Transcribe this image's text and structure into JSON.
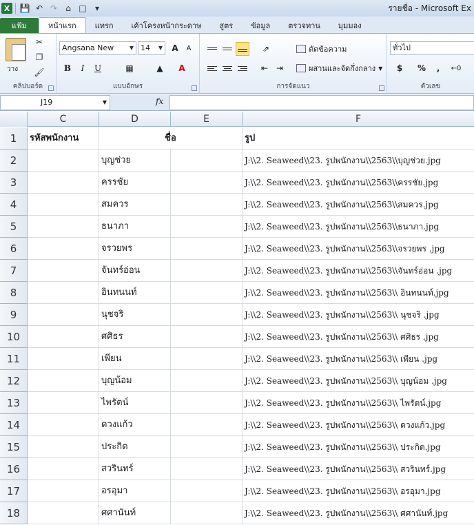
{
  "window": {
    "title": "รายชื่อ - Microsoft Ex"
  },
  "ribbon": {
    "file_tab": "แฟ้ม",
    "tabs": [
      "หน้าแรก",
      "แทรก",
      "เค้าโครงหน้ากระดาษ",
      "สูตร",
      "ข้อมูล",
      "ตรวจทาน",
      "มุมมอง"
    ],
    "clipboard": {
      "paste_label": "วาง",
      "group_label": "คลิปบอร์ด"
    },
    "font": {
      "name": "Angsana New",
      "size": "14",
      "group_label": "แบบอักษร",
      "bold": "B",
      "italic": "I",
      "underline": "U",
      "grow": "A",
      "shrink": "A",
      "color": "A"
    },
    "alignment": {
      "wrap_text": "ตัดข้อความ",
      "merge_center": "ผสานและจัดกึ่งกลาง",
      "group_label": "การจัดแนว"
    },
    "number": {
      "format": "ทั่วไป",
      "currency": "$",
      "percent": "%",
      "comma": ",",
      "group_label": "ตัวเลข"
    }
  },
  "formula_bar": {
    "name_box": "J19",
    "fx": "fx",
    "value": ""
  },
  "grid": {
    "columns": [
      "C",
      "D",
      "E",
      "F"
    ],
    "header_row": {
      "row": "1",
      "c": "รหัสพนักงาน",
      "de": "ชื่อ",
      "f": "รูป"
    },
    "rows": [
      {
        "row": "2",
        "name": "บุญช่วย",
        "path": "J:\\\\2. Seaweed\\\\23. รูปพนักงาน\\\\2563\\\\บุญช่วย.jpg"
      },
      {
        "row": "3",
        "name": "ครรชัย",
        "path": "J:\\\\2. Seaweed\\\\23. รูปพนักงาน\\\\2563\\\\ครรชัย.jpg"
      },
      {
        "row": "4",
        "name": "สมควร",
        "path": "J:\\\\2. Seaweed\\\\23. รูปพนักงาน\\\\2563\\\\สมควร.jpg"
      },
      {
        "row": "5",
        "name": "ธนาภา",
        "path": "J:\\\\2. Seaweed\\\\23. รูปพนักงาน\\\\2563\\\\ธนาภา.jpg"
      },
      {
        "row": "6",
        "name": "จรวยพร",
        "path": "J:\\\\2. Seaweed\\\\23. รูปพนักงาน\\\\2563\\\\จรวยพร .jpg"
      },
      {
        "row": "7",
        "name": "จันทร์อ่อน",
        "path": "J:\\\\2. Seaweed\\\\23. รูปพนักงาน\\\\2563\\\\จันทร์อ่อน .jpg"
      },
      {
        "row": "8",
        "name": "อินทนนท์",
        "path": "J:\\\\2. Seaweed\\\\23. รูปพนักงาน\\\\2563\\\\ อินทนนท์.jpg"
      },
      {
        "row": "9",
        "name": " นุชจริ",
        "path": "J:\\\\2. Seaweed\\\\23. รูปพนักงาน\\\\2563\\\\ นุชจริ .jpg"
      },
      {
        "row": "10",
        "name": " ศศิธร",
        "path": "J:\\\\2. Seaweed\\\\23. รูปพนักงาน\\\\2563\\\\ ศศิธร .jpg"
      },
      {
        "row": "11",
        "name": " เพียน",
        "path": "J:\\\\2. Seaweed\\\\23. รูปพนักงาน\\\\2563\\\\ เพียน .jpg"
      },
      {
        "row": "12",
        "name": " บุญน้อม",
        "path": "J:\\\\2. Seaweed\\\\23. รูปพนักงาน\\\\2563\\\\ บุญน้อม .jpg"
      },
      {
        "row": "13",
        "name": " ไพรัตน์",
        "path": "J:\\\\2. Seaweed\\\\23. รูปพนักงาน\\\\2563\\\\ ไพรัตน์.jpg"
      },
      {
        "row": "14",
        "name": " ดวงแก้ว",
        "path": "J:\\\\2. Seaweed\\\\23. รูปพนักงาน\\\\2563\\\\ ดวงแก้ว.jpg"
      },
      {
        "row": "15",
        "name": " ประกิต",
        "path": "J:\\\\2. Seaweed\\\\23. รูปพนักงาน\\\\2563\\\\ ประกิต.jpg"
      },
      {
        "row": "16",
        "name": " สวรินทร์",
        "path": "J:\\\\2. Seaweed\\\\23. รูปพนักงาน\\\\2563\\\\ สวรินทร์.jpg"
      },
      {
        "row": "17",
        "name": " อรอุมา",
        "path": "J:\\\\2. Seaweed\\\\23. รูปพนักงาน\\\\2563\\\\ อรอุมา.jpg"
      },
      {
        "row": "18",
        "name": " ศศานันท์",
        "path": "J:\\\\2. Seaweed\\\\23. รูปพนักงาน\\\\2563\\\\ ศศานันท์.jpg"
      }
    ]
  },
  "icons": [
    "excel-icon",
    "save-icon",
    "undo-icon",
    "redo-icon",
    "home-icon",
    "new-doc-icon",
    "customize-icon",
    "paste-icon",
    "cut-icon",
    "copy-icon",
    "format-painter-icon",
    "borders-icon",
    "fill-color-icon",
    "align-top-icon",
    "align-middle-icon",
    "align-bottom-icon",
    "orientation-icon",
    "align-left-icon",
    "align-center-icon",
    "align-right-icon",
    "decrease-indent-icon",
    "increase-indent-icon"
  ],
  "colors": {
    "file_tab": "#2e7a3a",
    "selected_button": "#fde38a",
    "grid_line": "#d6dbe2",
    "header_fill": "#e1e8f2"
  }
}
